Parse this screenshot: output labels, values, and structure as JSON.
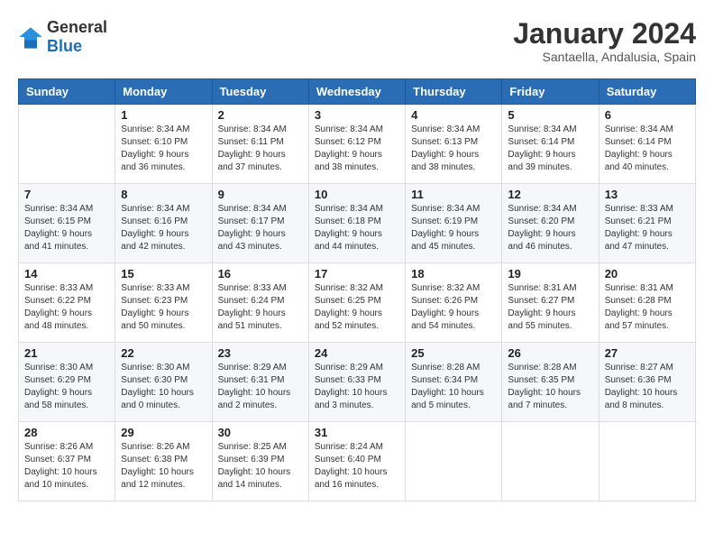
{
  "header": {
    "logo_general": "General",
    "logo_blue": "Blue",
    "title": "January 2024",
    "subtitle": "Santaella, Andalusia, Spain"
  },
  "days_of_week": [
    "Sunday",
    "Monday",
    "Tuesday",
    "Wednesday",
    "Thursday",
    "Friday",
    "Saturday"
  ],
  "weeks": [
    [
      {
        "day": "",
        "info": ""
      },
      {
        "day": "1",
        "info": "Sunrise: 8:34 AM\nSunset: 6:10 PM\nDaylight: 9 hours\nand 36 minutes."
      },
      {
        "day": "2",
        "info": "Sunrise: 8:34 AM\nSunset: 6:11 PM\nDaylight: 9 hours\nand 37 minutes."
      },
      {
        "day": "3",
        "info": "Sunrise: 8:34 AM\nSunset: 6:12 PM\nDaylight: 9 hours\nand 38 minutes."
      },
      {
        "day": "4",
        "info": "Sunrise: 8:34 AM\nSunset: 6:13 PM\nDaylight: 9 hours\nand 38 minutes."
      },
      {
        "day": "5",
        "info": "Sunrise: 8:34 AM\nSunset: 6:14 PM\nDaylight: 9 hours\nand 39 minutes."
      },
      {
        "day": "6",
        "info": "Sunrise: 8:34 AM\nSunset: 6:14 PM\nDaylight: 9 hours\nand 40 minutes."
      }
    ],
    [
      {
        "day": "7",
        "info": "Sunrise: 8:34 AM\nSunset: 6:15 PM\nDaylight: 9 hours\nand 41 minutes."
      },
      {
        "day": "8",
        "info": "Sunrise: 8:34 AM\nSunset: 6:16 PM\nDaylight: 9 hours\nand 42 minutes."
      },
      {
        "day": "9",
        "info": "Sunrise: 8:34 AM\nSunset: 6:17 PM\nDaylight: 9 hours\nand 43 minutes."
      },
      {
        "day": "10",
        "info": "Sunrise: 8:34 AM\nSunset: 6:18 PM\nDaylight: 9 hours\nand 44 minutes."
      },
      {
        "day": "11",
        "info": "Sunrise: 8:34 AM\nSunset: 6:19 PM\nDaylight: 9 hours\nand 45 minutes."
      },
      {
        "day": "12",
        "info": "Sunrise: 8:34 AM\nSunset: 6:20 PM\nDaylight: 9 hours\nand 46 minutes."
      },
      {
        "day": "13",
        "info": "Sunrise: 8:33 AM\nSunset: 6:21 PM\nDaylight: 9 hours\nand 47 minutes."
      }
    ],
    [
      {
        "day": "14",
        "info": "Sunrise: 8:33 AM\nSunset: 6:22 PM\nDaylight: 9 hours\nand 48 minutes."
      },
      {
        "day": "15",
        "info": "Sunrise: 8:33 AM\nSunset: 6:23 PM\nDaylight: 9 hours\nand 50 minutes."
      },
      {
        "day": "16",
        "info": "Sunrise: 8:33 AM\nSunset: 6:24 PM\nDaylight: 9 hours\nand 51 minutes."
      },
      {
        "day": "17",
        "info": "Sunrise: 8:32 AM\nSunset: 6:25 PM\nDaylight: 9 hours\nand 52 minutes."
      },
      {
        "day": "18",
        "info": "Sunrise: 8:32 AM\nSunset: 6:26 PM\nDaylight: 9 hours\nand 54 minutes."
      },
      {
        "day": "19",
        "info": "Sunrise: 8:31 AM\nSunset: 6:27 PM\nDaylight: 9 hours\nand 55 minutes."
      },
      {
        "day": "20",
        "info": "Sunrise: 8:31 AM\nSunset: 6:28 PM\nDaylight: 9 hours\nand 57 minutes."
      }
    ],
    [
      {
        "day": "21",
        "info": "Sunrise: 8:30 AM\nSunset: 6:29 PM\nDaylight: 9 hours\nand 58 minutes."
      },
      {
        "day": "22",
        "info": "Sunrise: 8:30 AM\nSunset: 6:30 PM\nDaylight: 10 hours\nand 0 minutes."
      },
      {
        "day": "23",
        "info": "Sunrise: 8:29 AM\nSunset: 6:31 PM\nDaylight: 10 hours\nand 2 minutes."
      },
      {
        "day": "24",
        "info": "Sunrise: 8:29 AM\nSunset: 6:33 PM\nDaylight: 10 hours\nand 3 minutes."
      },
      {
        "day": "25",
        "info": "Sunrise: 8:28 AM\nSunset: 6:34 PM\nDaylight: 10 hours\nand 5 minutes."
      },
      {
        "day": "26",
        "info": "Sunrise: 8:28 AM\nSunset: 6:35 PM\nDaylight: 10 hours\nand 7 minutes."
      },
      {
        "day": "27",
        "info": "Sunrise: 8:27 AM\nSunset: 6:36 PM\nDaylight: 10 hours\nand 8 minutes."
      }
    ],
    [
      {
        "day": "28",
        "info": "Sunrise: 8:26 AM\nSunset: 6:37 PM\nDaylight: 10 hours\nand 10 minutes."
      },
      {
        "day": "29",
        "info": "Sunrise: 8:26 AM\nSunset: 6:38 PM\nDaylight: 10 hours\nand 12 minutes."
      },
      {
        "day": "30",
        "info": "Sunrise: 8:25 AM\nSunset: 6:39 PM\nDaylight: 10 hours\nand 14 minutes."
      },
      {
        "day": "31",
        "info": "Sunrise: 8:24 AM\nSunset: 6:40 PM\nDaylight: 10 hours\nand 16 minutes."
      },
      {
        "day": "",
        "info": ""
      },
      {
        "day": "",
        "info": ""
      },
      {
        "day": "",
        "info": ""
      }
    ]
  ]
}
